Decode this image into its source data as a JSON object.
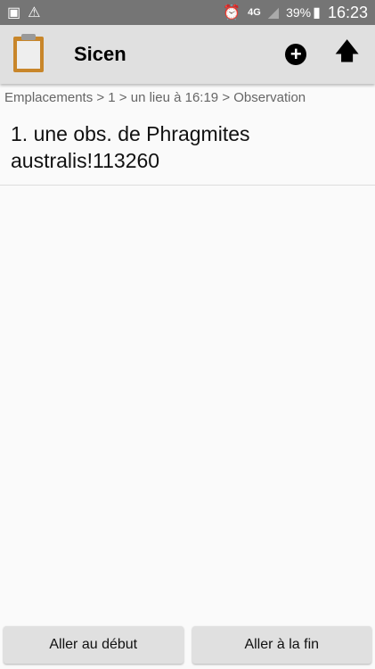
{
  "status": {
    "battery": "39%",
    "time": "16:23",
    "network": "4G",
    "icons": [
      "image-icon",
      "warning-icon",
      "alarm-icon",
      "signal-icon",
      "battery-icon"
    ]
  },
  "toolbar": {
    "title": "Sicen",
    "icons": [
      "clipboard-icon",
      "add-circle-icon",
      "arrow-up-icon"
    ]
  },
  "breadcrumb": "Emplacements > 1 > un lieu à 16:19 > Observation",
  "list": [
    {
      "label": "1. une obs. de Phragmites australis!113260"
    }
  ],
  "buttons": {
    "start": "Aller au début",
    "end": "Aller à la fin"
  }
}
